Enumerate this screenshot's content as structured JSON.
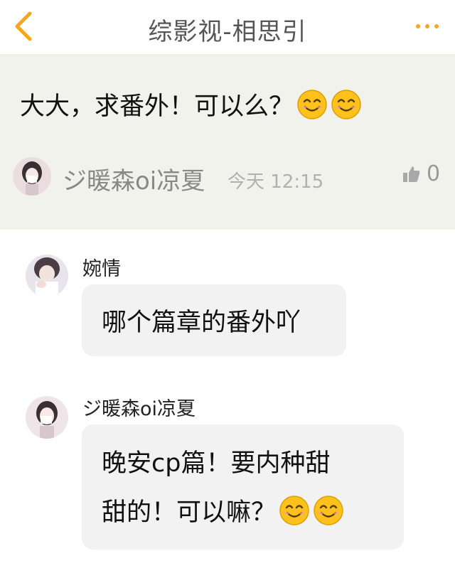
{
  "header": {
    "title": "综影视-相思引",
    "back_icon": "chevron-left-icon",
    "more_icon": "more-dots-icon",
    "accent_color": "#f5a623"
  },
  "post": {
    "text": "大大，求番外！可以么？",
    "emoji": [
      "smile-emoji",
      "smile-emoji"
    ],
    "user": "ジ暖森oi凉夏",
    "time": "今天 12:15",
    "like_count": "0",
    "background": "#f2f2ed"
  },
  "replies": [
    {
      "user": "婉情",
      "text": "哪个篇章的番外吖"
    },
    {
      "user": "ジ暖森oi凉夏",
      "text_line1": "晚安cp篇！要内种甜",
      "text_line2": "甜的！可以嘛？",
      "emoji": [
        "smile-emoji",
        "smile-emoji"
      ]
    }
  ]
}
